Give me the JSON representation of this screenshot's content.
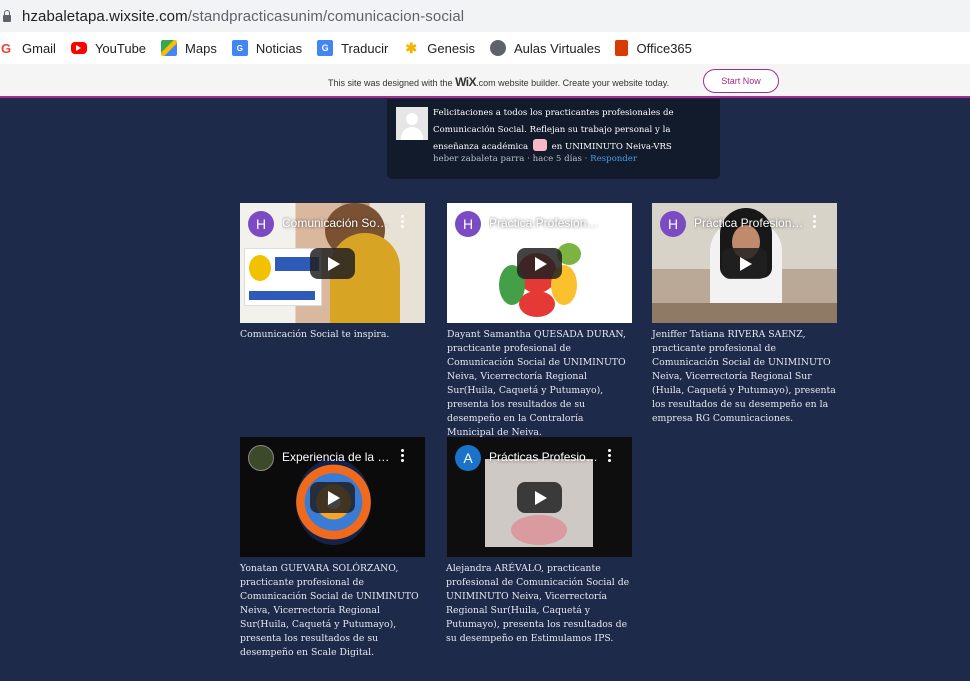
{
  "browser": {
    "url_domain": "hzabaletapa.wixsite.com",
    "url_path": "/standpracticasunim/comunicacion-social"
  },
  "bookmarks": [
    {
      "label": "Gmail",
      "icon": "google-icon"
    },
    {
      "label": "YouTube",
      "icon": "youtube-icon"
    },
    {
      "label": "Maps",
      "icon": "maps-icon"
    },
    {
      "label": "Noticias",
      "icon": "news-icon"
    },
    {
      "label": "Traducir",
      "icon": "translate-icon"
    },
    {
      "label": "Genesis",
      "icon": "genesis-icon"
    },
    {
      "label": "Aulas Virtuales",
      "icon": "globe-icon"
    },
    {
      "label": "Office365",
      "icon": "office-icon"
    }
  ],
  "wix_banner": {
    "text_before": "This site was designed with the ",
    "logo": "WiX",
    "text_after": ".com website builder. Create your website today.",
    "button": "Start Now",
    "accent": "#a62c8f"
  },
  "comment": {
    "text_part1": "Felicitaciones a todos los practicantes profesionales de Comunicación Social. Reflejan su trabajo personal y la enseñanza académica",
    "text_part2": "en UNIMINUTO Neiva-VRS",
    "author": "heber zabaleta parra",
    "time": "hace 5 días",
    "reply": "Responder"
  },
  "videos": [
    {
      "channel_initial": "H",
      "channel_color": "#7b4bc4",
      "title": "Comunicación Social te inspira",
      "caption": "Comunicación Social te inspira."
    },
    {
      "channel_initial": "H",
      "channel_color": "#7b4bc4",
      "title": "Práctica Profesional Dayant",
      "caption": "Dayant Samantha QUESADA DURAN, practicante profesional de Comunicación Social de UNIMINUTO Neiva, Vicerrectoría Regional Sur(Huila, Caquetá y Putumayo), presenta los resultados de su desempeño en la Contraloría Municipal de Neiva."
    },
    {
      "channel_initial": "H",
      "channel_color": "#7b4bc4",
      "title": "Práctica Profesional Jeniffer",
      "caption": "Jeniffer Tatiana RIVERA SAENZ, practicante profesional de Comunicación Social de UNIMINUTO Neiva, Vicerrectoría Regional Sur (Huila, Caquetá y Putumayo), presenta los resultados de su desempeño en la empresa RG Comunicaciones."
    },
    {
      "channel_initial": "",
      "channel_color": "#3a4a2a",
      "title": "Experiencia de la práctica",
      "caption": "Yonatan GUEVARA SOLÓRZANO, practicante profesional de Comunicación Social de UNIMINUTO Neiva, Vicerrectoría Regional Sur(Huila, Caquetá y Putumayo), presenta los resultados de su desempeño en Scale Digital."
    },
    {
      "channel_initial": "A",
      "channel_color": "#1a73c8",
      "title": "Prácticas Profesionales",
      "caption": "Alejandra ARÉVALO, practicante profesional de Comunicación Social de UNIMINUTO Neiva, Vicerrectoría Regional Sur(Huila, Caquetá y Putumayo), presenta los resultados de su desempeño en Estimulamos IPS."
    }
  ]
}
